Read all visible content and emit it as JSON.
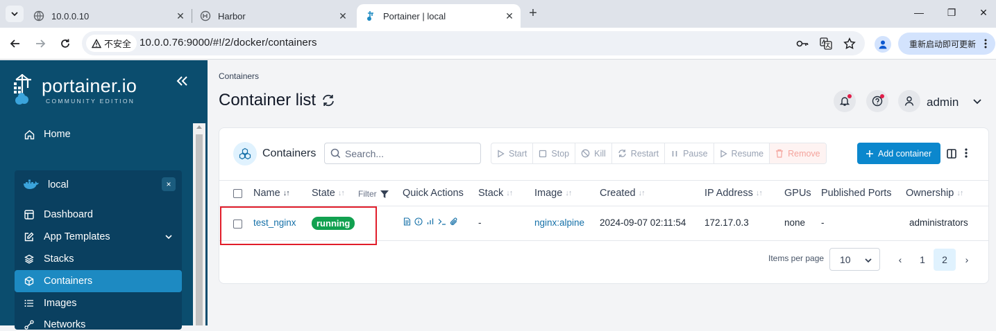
{
  "browser": {
    "tabs": [
      {
        "title": "10.0.0.10",
        "active": false
      },
      {
        "title": "Harbor",
        "active": false
      },
      {
        "title": "Portainer | local",
        "active": true
      }
    ],
    "insecure_label": "不安全",
    "url": "10.0.0.76:9000/#!/2/docker/containers",
    "update_button": "重新启动即可更新",
    "window_controls": {
      "minimize": "—",
      "restore": "❐",
      "close": "✕"
    }
  },
  "sidebar": {
    "logo_text": "portainer.io",
    "logo_subtitle": "COMMUNITY EDITION",
    "home_label": "Home",
    "environment": {
      "name": "local",
      "close_label": "×",
      "items": [
        {
          "label": "Dashboard",
          "icon": "dashboard-icon"
        },
        {
          "label": "App Templates",
          "icon": "edit-icon",
          "expandable": true
        },
        {
          "label": "Stacks",
          "icon": "layers-icon"
        },
        {
          "label": "Containers",
          "icon": "box-icon",
          "active": true
        },
        {
          "label": "Images",
          "icon": "list-icon"
        },
        {
          "label": "Networks",
          "icon": "network-icon"
        }
      ]
    }
  },
  "main": {
    "breadcrumb": "Containers",
    "page_title": "Container list",
    "user": "admin",
    "card": {
      "title": "Containers",
      "search_placeholder": "Search...",
      "actions": [
        {
          "label": "Start",
          "icon": "play-icon"
        },
        {
          "label": "Stop",
          "icon": "stop-icon"
        },
        {
          "label": "Kill",
          "icon": "kill-icon"
        },
        {
          "label": "Restart",
          "icon": "restart-icon"
        },
        {
          "label": "Pause",
          "icon": "pause-icon"
        },
        {
          "label": "Resume",
          "icon": "resume-icon"
        },
        {
          "label": "Remove",
          "icon": "trash-icon"
        }
      ],
      "add_button": "Add container",
      "columns": {
        "name": "Name",
        "state": "State",
        "filter": "Filter",
        "quick_actions": "Quick Actions",
        "stack": "Stack",
        "image": "Image",
        "created": "Created",
        "ip": "IP Address",
        "gpus": "GPUs",
        "ports": "Published Ports",
        "ownership": "Ownership"
      },
      "rows": [
        {
          "name": "test_nginx",
          "state": "running",
          "stack": "-",
          "image": "nginx:alpine",
          "created": "2024-09-07 02:11:54",
          "ip": "172.17.0.3",
          "gpus": "none",
          "ports": "-",
          "ownership": "administrators"
        }
      ],
      "pagination": {
        "items_per_page_label": "Items per page",
        "items_per_page": "10",
        "prev": "‹",
        "next": "›",
        "pages": [
          "1",
          "2"
        ],
        "current_page": "2"
      }
    }
  },
  "colors": {
    "sidebar_bg": "#0b4d6e",
    "accent": "#0b87cd",
    "running_badge": "#12a150",
    "highlight_box": "#e11d2a"
  }
}
